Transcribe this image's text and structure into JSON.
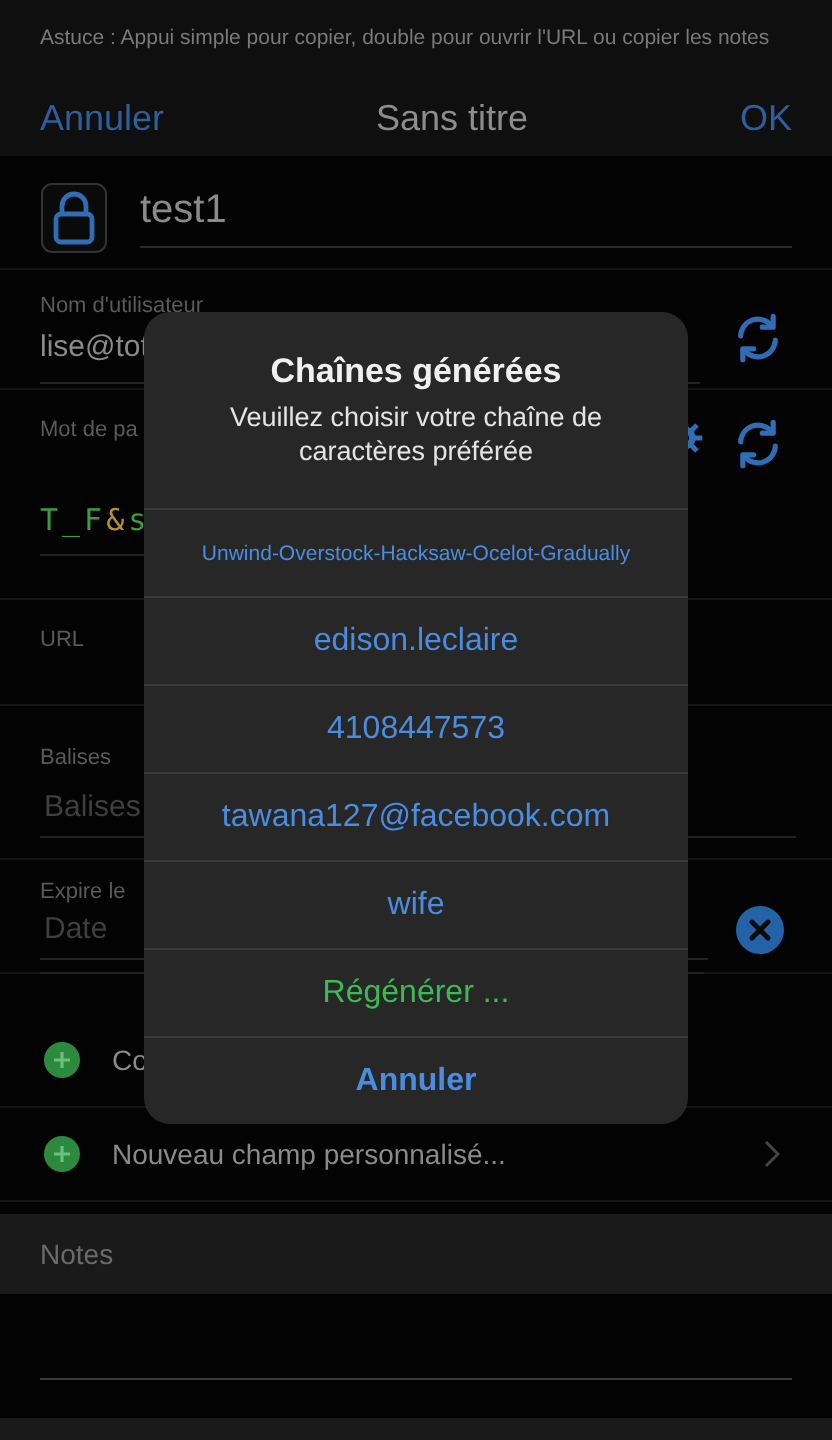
{
  "tip": "Astuce : Appui simple pour copier, double pour ouvrir l'URL ou copier les notes",
  "nav": {
    "cancel": "Annuler",
    "title": "Sans titre",
    "ok": "OK"
  },
  "entry_title": "test1",
  "username": {
    "label": "Nom d'utilisateur",
    "value": "lise@tot"
  },
  "password": {
    "label": "Mot de pa",
    "segments": [
      {
        "text": "T_F",
        "color": "#3f9b3f"
      },
      {
        "text": "&",
        "color": "#b8922c"
      },
      {
        "text": "s",
        "color": "#3f9b3f"
      }
    ]
  },
  "url": {
    "label": "URL"
  },
  "tags": {
    "label": "Balises",
    "placeholder": "Balises"
  },
  "expiry": {
    "label": "Expire le",
    "placeholder": "Date"
  },
  "custom_rows": [
    {
      "label": "Co",
      "chevron": false
    },
    {
      "label": "Nouveau champ personnalisé...",
      "chevron": true
    }
  ],
  "notes": {
    "header": "Notes"
  },
  "dialog": {
    "title": "Chaînes générées",
    "message": "Veuillez choisir votre chaîne de caractères préférée",
    "options": [
      {
        "text": "Unwind-Overstock-Hacksaw-Ocelot-Gradually",
        "kind": "small"
      },
      {
        "text": "edison.leclaire",
        "kind": "normal"
      },
      {
        "text": "4108447573",
        "kind": "normal"
      },
      {
        "text": "tawana127@facebook.com",
        "kind": "normal"
      },
      {
        "text": "wife",
        "kind": "normal"
      },
      {
        "text": "Régénérer ...",
        "kind": "regenerate"
      },
      {
        "text": "Annuler",
        "kind": "cancel"
      }
    ]
  }
}
